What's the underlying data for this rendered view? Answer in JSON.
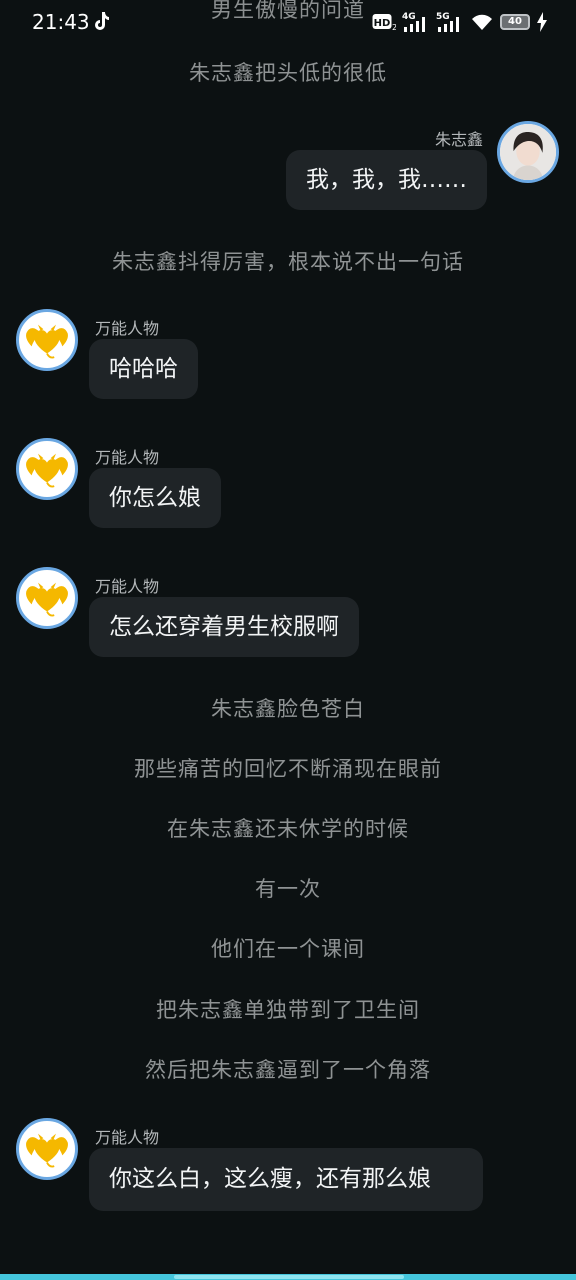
{
  "status_bar": {
    "time": "21:43",
    "hd_label": "HD",
    "sim1_label": "4G",
    "sim2_label": "5G",
    "battery": "40"
  },
  "story": {
    "top_partial": "男生傲慢的问道",
    "n1": "朱志鑫把头低的很低",
    "n2": "朱志鑫抖得厉害，根本说不出一句话",
    "n3": "朱志鑫脸色苍白",
    "n4": "那些痛苦的回忆不断涌现在眼前",
    "n5": "在朱志鑫还未休学的时候",
    "n6": "有一次",
    "n7": "他们在一个课间",
    "n8": "把朱志鑫单独带到了卫生间",
    "n9": "然后把朱志鑫逼到了一个角落"
  },
  "messages": {
    "m1": {
      "name": "朱志鑫",
      "text": "我，我，我……"
    },
    "m2": {
      "name": "万能人物",
      "text": "哈哈哈"
    },
    "m3": {
      "name": "万能人物",
      "text": "你怎么娘"
    },
    "m4": {
      "name": "万能人物",
      "text": "怎么还穿着男生校服啊"
    },
    "m5": {
      "name": "万能人物",
      "text": "你这么白，这么瘦，还有那么娘"
    }
  },
  "colors": {
    "background": "#0c1112",
    "bubble": "#1f2427",
    "avatar_ring": "#6aa7e2",
    "heart": "#f5b800",
    "bottom_bar": "#44c6dc"
  },
  "icons": {
    "tiktok": "tiktok-icon",
    "signal": "signal-icon",
    "wifi": "wifi-icon",
    "battery": "battery-icon",
    "charging": "charging-bolt-icon",
    "avatar_npc": "winged-heart-avatar",
    "avatar_user": "portrait-avatar"
  }
}
